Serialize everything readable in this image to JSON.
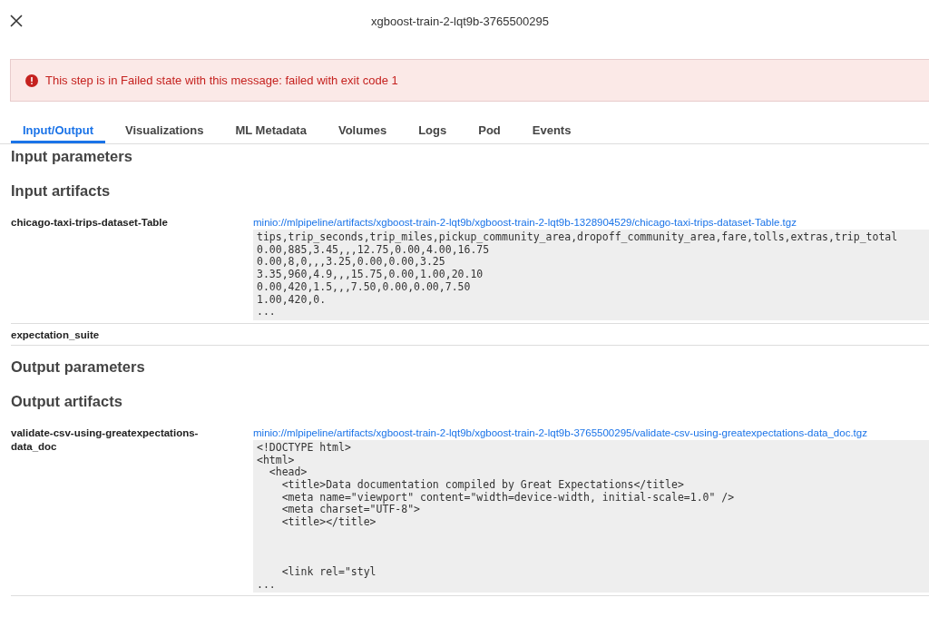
{
  "header": {
    "title": "xgboost-train-2-lqt9b-3765500295"
  },
  "error_banner": {
    "message": "This step is in Failed state with this message: failed with exit code 1"
  },
  "tabs": [
    {
      "label": "Input/Output",
      "selected": true
    },
    {
      "label": "Visualizations",
      "selected": false
    },
    {
      "label": "ML Metadata",
      "selected": false
    },
    {
      "label": "Volumes",
      "selected": false
    },
    {
      "label": "Logs",
      "selected": false
    },
    {
      "label": "Pod",
      "selected": false
    },
    {
      "label": "Events",
      "selected": false
    }
  ],
  "sections": [
    {
      "title": "Input parameters"
    },
    {
      "title": "Input artifacts",
      "items": [
        {
          "name": "chicago-taxi-trips-dataset-Table",
          "link": "minio://mlpipeline/artifacts/xgboost-train-2-lqt9b/xgboost-train-2-lqt9b-1328904529/chicago-taxi-trips-dataset-Table.tgz",
          "preview": [
            "tips,trip_seconds,trip_miles,pickup_community_area,dropoff_community_area,fare,tolls,extras,trip_total",
            "0.00,885,3.45,,,12.75,0.00,4.00,16.75",
            "0.00,8,0,,,3.25,0.00,0.00,3.25",
            "3.35,960,4.9,,,15.75,0.00,1.00,20.10",
            "0.00,420,1.5,,,7.50,0.00,0.00,7.50",
            "1.00,420,0.",
            "..."
          ]
        },
        {
          "name": "expectation_suite"
        }
      ]
    },
    {
      "title": "Output parameters"
    },
    {
      "title": "Output artifacts",
      "items": [
        {
          "name": "validate-csv-using-greatexpectations-data_doc",
          "link": "minio://mlpipeline/artifacts/xgboost-train-2-lqt9b/xgboost-train-2-lqt9b-3765500295/validate-csv-using-greatexpectations-data_doc.tgz",
          "preview": [
            "<!DOCTYPE html>",
            "<html>",
            "  <head>",
            "    <title>Data documentation compiled by Great Expectations</title>",
            "    <meta name=\"viewport\" content=\"width=device-width, initial-scale=1.0\" />",
            "    <meta charset=\"UTF-8\">",
            "    <title></title>",
            "\n\n\n    <link rel=\"styl",
            "..."
          ]
        }
      ]
    }
  ]
}
